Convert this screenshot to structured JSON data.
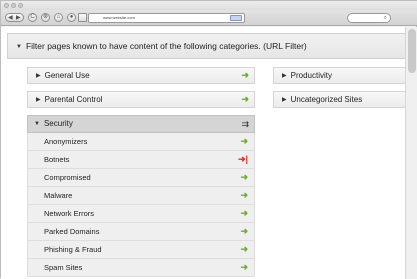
{
  "browser": {
    "url": "www.website.com",
    "nav_back": "◀",
    "nav_forward": "▶",
    "reload": "C",
    "stop": "⊗",
    "home": "⌂",
    "lock": "●",
    "search_glyph": "⌕"
  },
  "filter": {
    "header": "Filter pages known to have content of the following categories. (URL Filter)"
  },
  "categories_left": [
    {
      "label": "General Use",
      "state": "allow"
    },
    {
      "label": "Parental Control",
      "state": "allow"
    }
  ],
  "categories_right": [
    {
      "label": "Productivity"
    },
    {
      "label": "Uncategorized Sites"
    }
  ],
  "security": {
    "label": "Security",
    "items": [
      {
        "label": "Anonymizers",
        "state": "allow"
      },
      {
        "label": "Botnets",
        "state": "block"
      },
      {
        "label": "Compromised",
        "state": "allow"
      },
      {
        "label": "Malware",
        "state": "allow"
      },
      {
        "label": "Network Errors",
        "state": "allow"
      },
      {
        "label": "Parked Domains",
        "state": "allow"
      },
      {
        "label": "Phishing & Fraud",
        "state": "allow"
      },
      {
        "label": "Spam Sites",
        "state": "allow"
      }
    ]
  },
  "icons": {
    "allow": "➜",
    "block": "➜|",
    "mixed": "⇉"
  },
  "colors": {
    "allow": "#6cab3a",
    "block": "#d9322b"
  }
}
